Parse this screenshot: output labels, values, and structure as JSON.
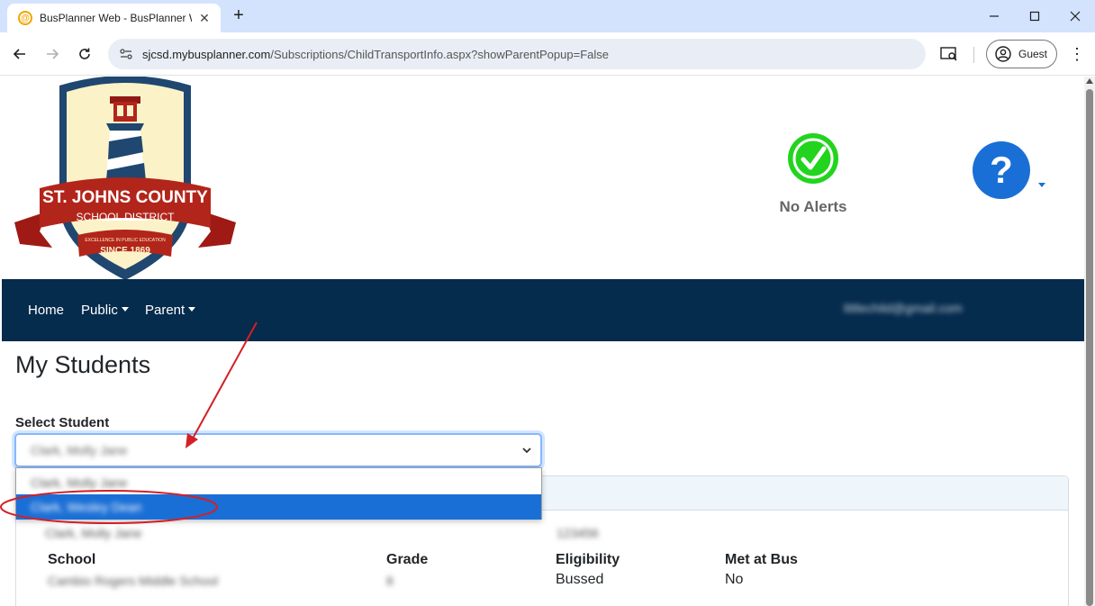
{
  "browser": {
    "tab_title": "BusPlanner Web - BusPlanner W",
    "url_host": "sjcsd.mybusplanner.com",
    "url_path": "/Subscriptions/ChildTransportInfo.aspx?showParentPopup=False",
    "profile_label": "Guest"
  },
  "logo": {
    "line1": "ST. JOHNS COUNTY",
    "line2": "SCHOOL DISTRICT",
    "motto": "EXCELLENCE IN PUBLIC EDUCATION",
    "since": "SINCE 1869"
  },
  "alerts": {
    "label": "No Alerts"
  },
  "nav": {
    "home": "Home",
    "public": "Public",
    "parent": "Parent",
    "user_email": "littlechild@gmail.com"
  },
  "main": {
    "title": "My Students",
    "select_label": "Select Student",
    "selected_student": "Clark, Molly Jane",
    "options": [
      "Clark, Molly Jane",
      "Clark, Wesley Dean"
    ]
  },
  "card": {
    "student_name": "Clark, Molly Jane",
    "student_id": "123456",
    "labels": {
      "school": "School",
      "grade": "Grade",
      "eligibility": "Eligibility",
      "met_at_bus": "Met at Bus"
    },
    "values": {
      "school": "Cambio Rogers Middle School",
      "grade": "8",
      "eligibility": "Bussed",
      "met_at_bus": "No"
    }
  },
  "colors": {
    "navbar": "#052b4d",
    "accent": "#1a6fd6",
    "alert_ok": "#22d41e",
    "annotation": "#d32027"
  }
}
